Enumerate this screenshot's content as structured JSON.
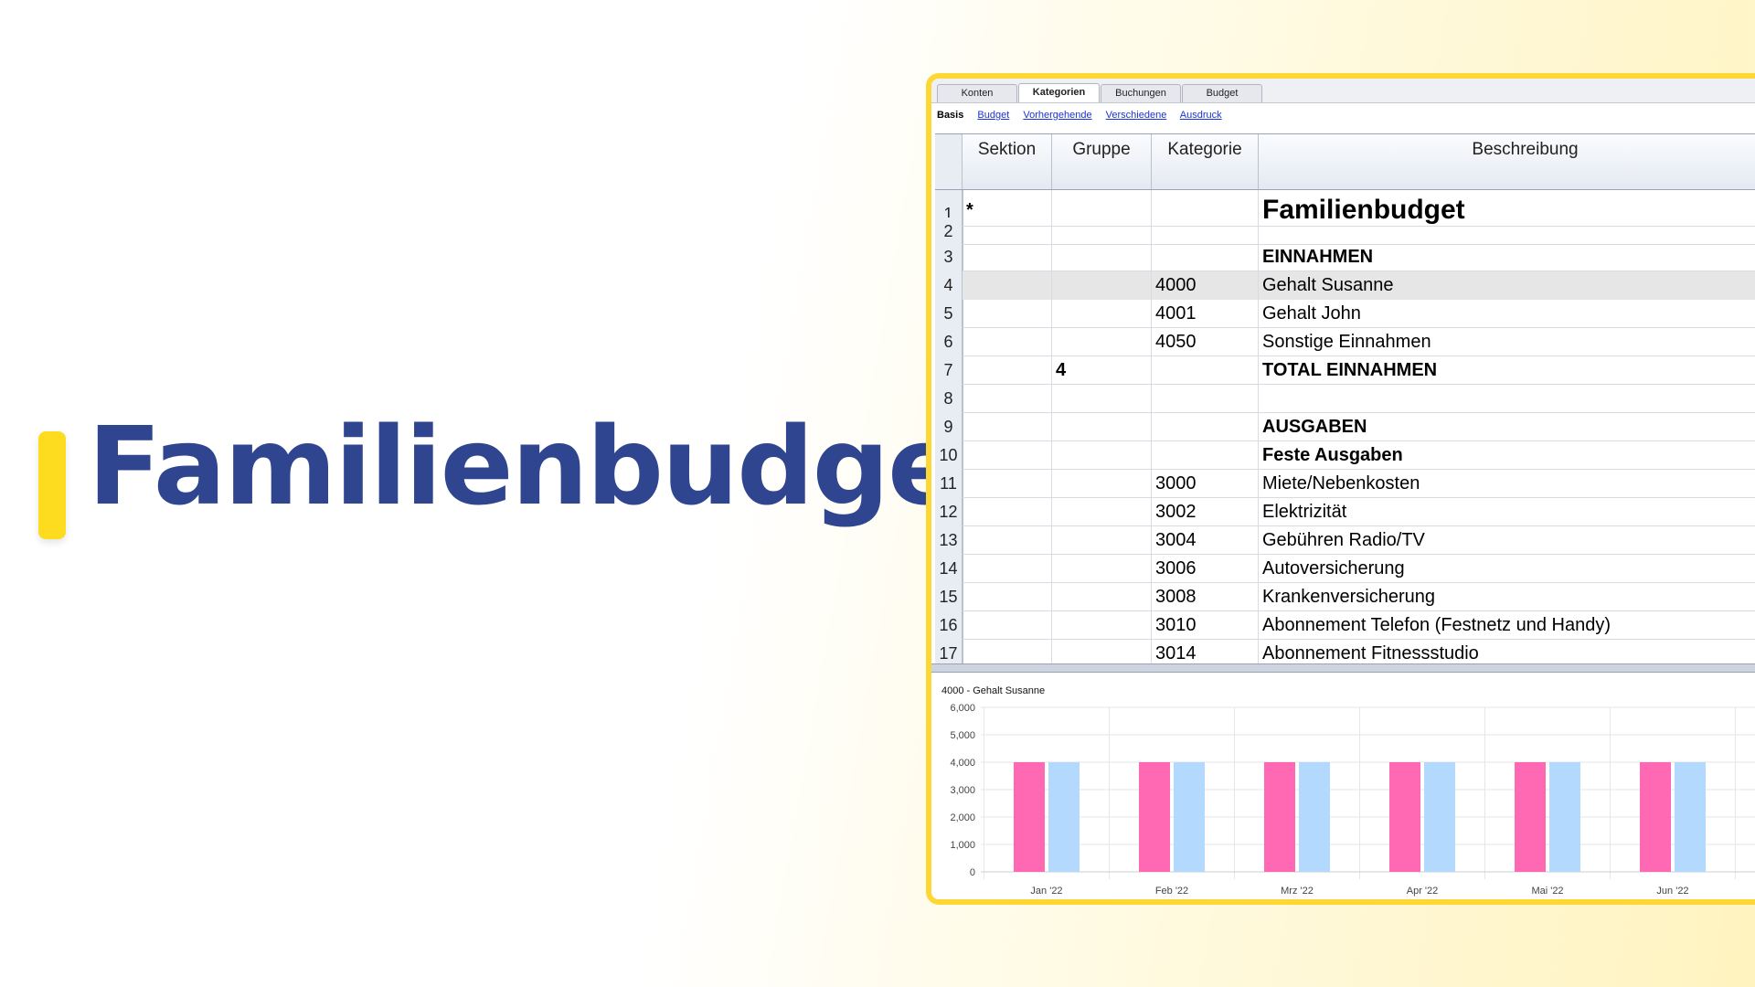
{
  "hero": {
    "title": "Familienbudget"
  },
  "tabs": [
    {
      "label": "Konten",
      "active": false
    },
    {
      "label": "Kategorien",
      "active": true
    },
    {
      "label": "Buchungen",
      "active": false
    },
    {
      "label": "Budget",
      "active": false
    }
  ],
  "subviews": {
    "current": "Basis",
    "links": [
      "Budget",
      "Vorhergehende",
      "Verschiedene",
      "Ausdruck"
    ]
  },
  "table": {
    "columns": [
      "Sektion",
      "Gruppe",
      "Kategorie",
      "Beschreibung"
    ],
    "rows": [
      {
        "num": "1",
        "sektion": "*",
        "gruppe": "",
        "kategorie": "",
        "beschreibung": "Familienbudget",
        "style": "title"
      },
      {
        "num": "2",
        "sektion": "",
        "gruppe": "",
        "kategorie": "",
        "beschreibung": "",
        "style": ""
      },
      {
        "num": "3",
        "sektion": "",
        "gruppe": "",
        "kategorie": "",
        "beschreibung": "EINNAHMEN",
        "style": "bold"
      },
      {
        "num": "4",
        "sektion": "",
        "gruppe": "",
        "kategorie": "4000",
        "beschreibung": "Gehalt Susanne",
        "style": "selected"
      },
      {
        "num": "5",
        "sektion": "",
        "gruppe": "",
        "kategorie": "4001",
        "beschreibung": "Gehalt John",
        "style": ""
      },
      {
        "num": "6",
        "sektion": "",
        "gruppe": "",
        "kategorie": "4050",
        "beschreibung": "Sonstige Einnahmen",
        "style": ""
      },
      {
        "num": "7",
        "sektion": "",
        "gruppe": "4",
        "kategorie": "",
        "beschreibung": "TOTAL EINNAHMEN",
        "style": "bold"
      },
      {
        "num": "8",
        "sektion": "",
        "gruppe": "",
        "kategorie": "",
        "beschreibung": "",
        "style": ""
      },
      {
        "num": "9",
        "sektion": "",
        "gruppe": "",
        "kategorie": "",
        "beschreibung": "AUSGABEN",
        "style": "bold"
      },
      {
        "num": "10",
        "sektion": "",
        "gruppe": "",
        "kategorie": "",
        "beschreibung": "Feste Ausgaben",
        "style": "bold"
      },
      {
        "num": "11",
        "sektion": "",
        "gruppe": "",
        "kategorie": "3000",
        "beschreibung": "Miete/Nebenkosten",
        "style": ""
      },
      {
        "num": "12",
        "sektion": "",
        "gruppe": "",
        "kategorie": "3002",
        "beschreibung": "Elektrizität",
        "style": ""
      },
      {
        "num": "13",
        "sektion": "",
        "gruppe": "",
        "kategorie": "3004",
        "beschreibung": "Gebühren Radio/TV",
        "style": ""
      },
      {
        "num": "14",
        "sektion": "",
        "gruppe": "",
        "kategorie": "3006",
        "beschreibung": "Autoversicherung",
        "style": ""
      },
      {
        "num": "15",
        "sektion": "",
        "gruppe": "",
        "kategorie": "3008",
        "beschreibung": "Krankenversicherung",
        "style": ""
      },
      {
        "num": "16",
        "sektion": "",
        "gruppe": "",
        "kategorie": "3010",
        "beschreibung": "Abonnement Telefon (Festnetz und Handy)",
        "style": ""
      },
      {
        "num": "17",
        "sektion": "",
        "gruppe": "",
        "kategorie": "3014",
        "beschreibung": "Abonnement Fitnessstudio",
        "style": ""
      }
    ]
  },
  "colors": {
    "accent": "#fdd835",
    "brand": "#2f4590",
    "series_a": "#ff69b4",
    "series_b": "#b3d9ff"
  },
  "chart_data": {
    "type": "bar",
    "title": "4000 - Gehalt Susanne",
    "categories": [
      "Jan '22",
      "Feb '22",
      "Mrz '22",
      "Apr '22",
      "Mai '22",
      "Jun '22"
    ],
    "series": [
      {
        "values": [
          4000,
          4000,
          4000,
          4000,
          4000,
          4000
        ],
        "color": "#ff69b4"
      },
      {
        "values": [
          4000,
          4000,
          4000,
          4000,
          4000,
          4000
        ],
        "color": "#b3d9ff"
      }
    ],
    "ylim": [
      0,
      6000
    ],
    "yticks": [
      "0",
      "1,000",
      "2,000",
      "3,000",
      "4,000",
      "5,000",
      "6,000"
    ],
    "grid": true
  }
}
